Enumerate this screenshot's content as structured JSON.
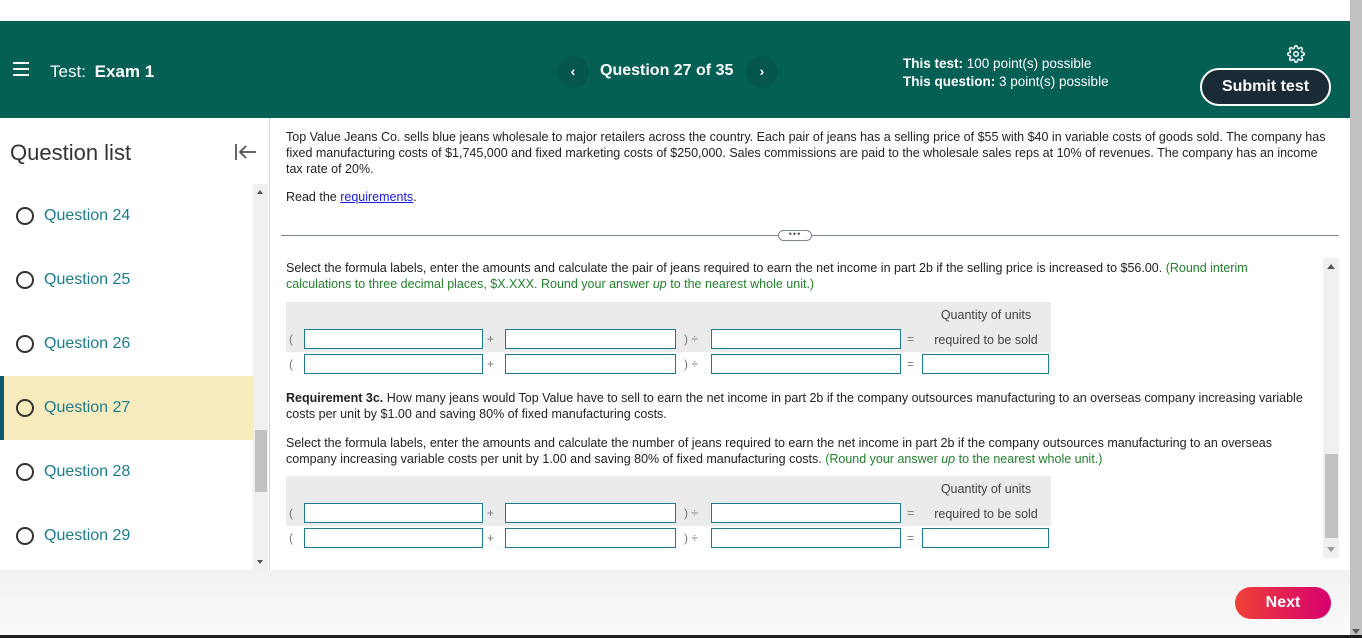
{
  "header": {
    "test_label": "Test:",
    "test_name": "Exam 1",
    "question_counter": "Question 27 of 35",
    "prev_icon": "chevron-left-icon",
    "next_icon": "chevron-right-icon",
    "this_test_label": "This test:",
    "this_test_value": "100 point(s) possible",
    "this_question_label": "This question:",
    "this_question_value": "3 point(s) possible",
    "submit_label": "Submit test",
    "colors": {
      "header_bg": "#046054",
      "submit_bg": "#1b2b35"
    }
  },
  "sidebar": {
    "title": "Question list",
    "items": [
      {
        "label": "Question 24",
        "active": false
      },
      {
        "label": "Question 25",
        "active": false
      },
      {
        "label": "Question 26",
        "active": false
      },
      {
        "label": "Question 27",
        "active": true
      },
      {
        "label": "Question 28",
        "active": false
      },
      {
        "label": "Question 29",
        "active": false
      }
    ],
    "active_color": "#f8ebbd"
  },
  "question": {
    "intro": "Top Value Jeans Co. sells blue jeans wholesale to major retailers across the country. Each pair of jeans has a selling price of $55 with $40 in variable costs of goods sold. The company has fixed manufacturing costs of $1,745,000 and fixed marketing costs of $250,000. Sales commissions are paid to the wholesale sales reps at 10% of revenues. The company has an income tax rate of 20%.",
    "read_prefix": "Read the ",
    "read_link": "requirements",
    "read_suffix": ".",
    "part1": {
      "instruction": "Select the formula labels, enter the amounts and calculate the pair of jeans required to earn the net income in part 2b if the selling price is increased to $56.00. ",
      "hint_a": "(Round interim calculations to three decimal places, $X.XXX. Round your answer ",
      "hint_em": "up",
      "hint_b": " to the nearest whole unit.)"
    },
    "req3c": {
      "bold": "Requirement 3c.",
      "text": " How many jeans would Top Value have to sell to earn the net income in part 2b if the company outsources manufacturing to an overseas company increasing variable costs per unit by $1.00 and saving 80% of fixed manufacturing costs."
    },
    "part2": {
      "instruction": "Select the formula labels, enter the amounts and calculate the number of jeans required to earn the net income in part 2b if the company outsources manufacturing to an overseas company increasing variable costs per unit by 1.00 and saving 80% of fixed manufacturing costs. ",
      "hint_a": "(Round your answer ",
      "hint_em": "up",
      "hint_b": " to the nearest whole unit.)"
    },
    "formula": {
      "open": "(",
      "plus": "+",
      "close_div": ") ÷",
      "equals": "=",
      "result_label_1": "Quantity of units",
      "result_label_2": "required to be sold",
      "row1": {
        "a": "",
        "b": "",
        "c": ""
      },
      "row2": {
        "a": "",
        "b": "",
        "c": "",
        "d": ""
      }
    }
  },
  "footer": {
    "next_label": "Next",
    "next_colors": [
      "#ef4136",
      "#d6006f"
    ]
  }
}
